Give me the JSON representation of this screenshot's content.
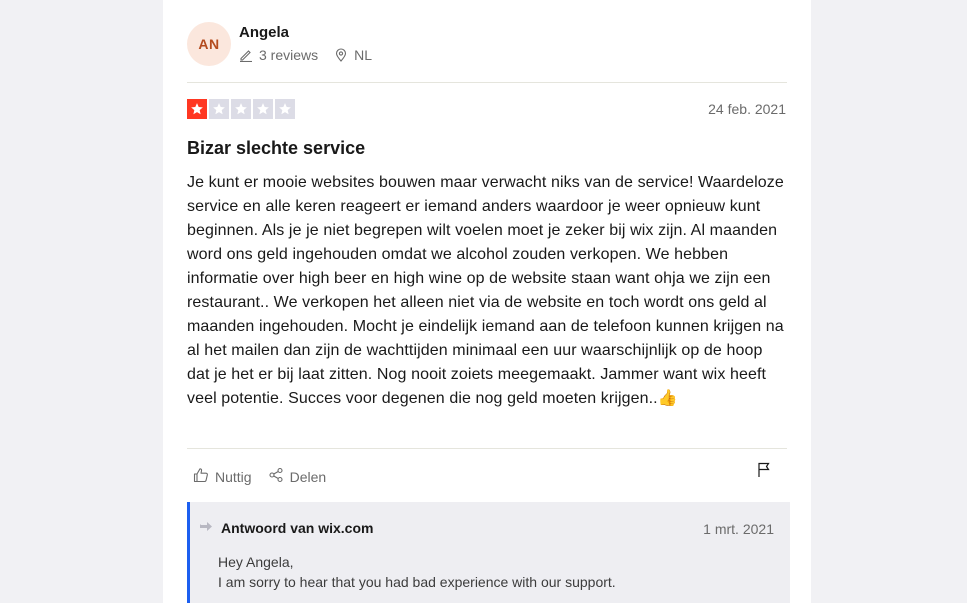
{
  "reviewer": {
    "initials": "AN",
    "name": "Angela",
    "reviews_count": "3 reviews",
    "country": "NL"
  },
  "review": {
    "rating": 1,
    "rating_max": 5,
    "rating_color": "#ff3722",
    "empty_star_color": "#dcdce6",
    "date": "24 feb. 2021",
    "title": "Bizar slechte service",
    "body": "Je kunt er mooie websites bouwen maar verwacht niks van de service! Waardeloze service en alle keren reageert er iemand anders waardoor je weer opnieuw kunt beginnen. Als je je niet begrepen wilt voelen moet je zeker bij wix zijn. Al maanden word ons geld ingehouden omdat we alcohol zouden verkopen. We hebben informatie over high beer en high wine op de website staan want ohja we zijn een restaurant.. We verkopen het alleen niet via de website en toch wordt ons geld al maanden ingehouden. Mocht je eindelijk iemand aan de telefoon kunnen krijgen na al het mailen dan zijn de wachttijden minimaal een uur waarschijnlijk op de hoop dat je het er bij laat zitten. Nog nooit zoiets meegemaakt. Jammer want wix heeft veel potentie. Succes voor degenen die nog geld moeten krijgen..👍"
  },
  "actions": {
    "useful_label": "Nuttig",
    "share_label": "Delen"
  },
  "reply": {
    "header": "Antwoord van wix.com",
    "date": "1 mrt. 2021",
    "line1": "Hey Angela,",
    "line2": "I am sorry to hear that you had bad experience with our support."
  }
}
